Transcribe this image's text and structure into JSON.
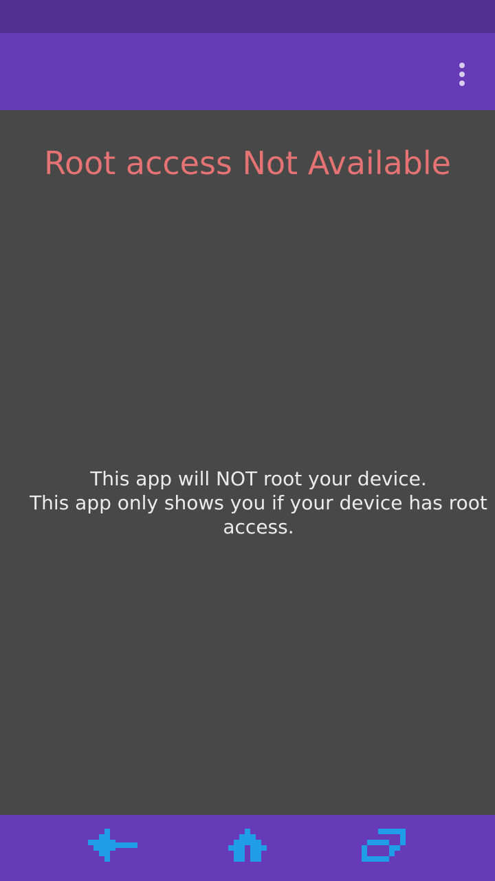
{
  "colors": {
    "status_bar": "#512f93",
    "app_bar": "#673ab7",
    "content_bg": "#484848",
    "status_text": "#e57373",
    "body_text": "#ececec",
    "nav_icon": "#1e9ee8"
  },
  "app_bar": {
    "menu_icon": "more-vert-icon"
  },
  "main": {
    "root_status": "Root access Not Available",
    "disclaimer_line1": "This app will NOT root your device.",
    "disclaimer_line2": "This app only shows you if your device has root access."
  },
  "nav_bar": {
    "buttons": [
      {
        "icon": "back-arrow-icon"
      },
      {
        "icon": "home-icon"
      },
      {
        "icon": "recent-apps-icon"
      }
    ]
  }
}
